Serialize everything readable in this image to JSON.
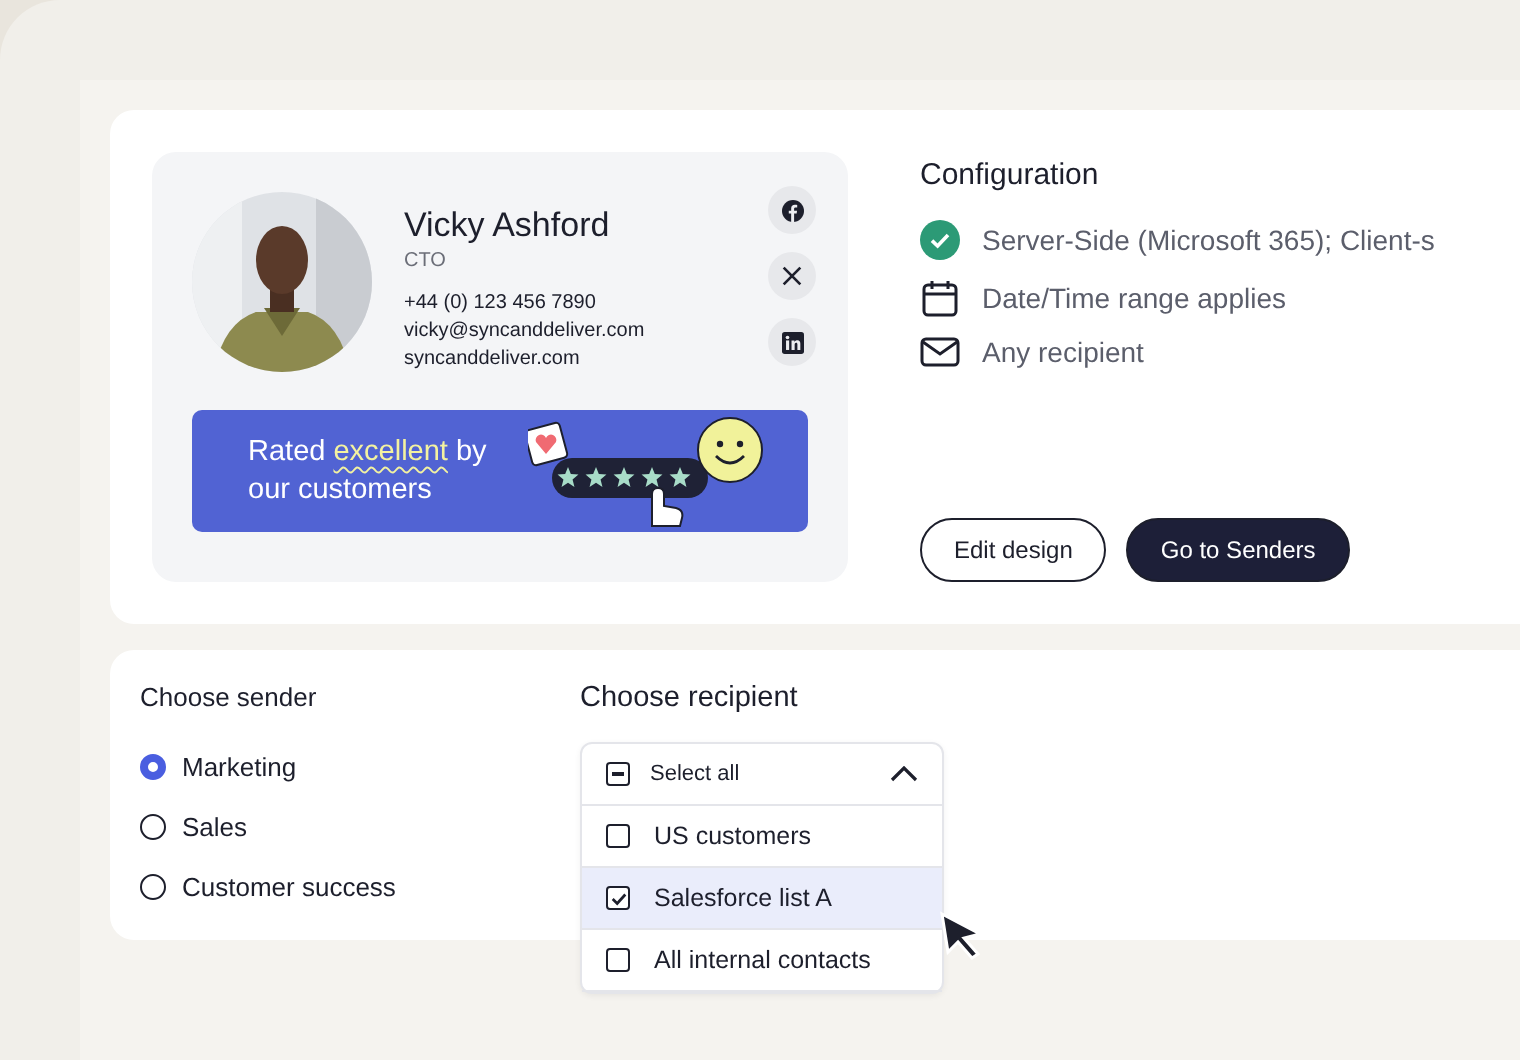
{
  "signature": {
    "name": "Vicky Ashford",
    "role": "CTO",
    "phone": "+44 (0) 123 456 7890",
    "email": "vicky@syncanddeliver.com",
    "website": "syncanddeliver.com",
    "socials": [
      {
        "kind": "facebook"
      },
      {
        "kind": "x"
      },
      {
        "kind": "linkedin"
      }
    ],
    "banner": {
      "text": "Rated *excellent* by our customers",
      "stars": 5
    }
  },
  "configuration": {
    "title": "Configuration",
    "items": [
      {
        "kind": "check",
        "text": "Server-Side (Microsoft 365); Client-s"
      },
      {
        "kind": "calendar",
        "text": "Date/Time range applies"
      },
      {
        "kind": "mail",
        "text": "Any recipient"
      }
    ],
    "buttons": [
      {
        "kind": "outline",
        "label": "Edit design"
      },
      {
        "kind": "primary",
        "label": "Go to Senders"
      }
    ]
  },
  "sender": {
    "title": "Choose sender",
    "options": [
      {
        "label": "Marketing",
        "selected": true
      },
      {
        "label": "Sales",
        "selected": false
      },
      {
        "label": "Customer success",
        "selected": false
      }
    ]
  },
  "recipient": {
    "title": "Choose recipient",
    "expanded": true,
    "select_all": {
      "label": "Select all",
      "indeterminate": true
    },
    "options": [
      {
        "label": "US customers",
        "checked": false,
        "highlighted": false
      },
      {
        "label": "Salesforce list A",
        "checked": true,
        "highlighted": true
      },
      {
        "label": "All internal contacts",
        "checked": false,
        "highlighted": false
      }
    ]
  }
}
